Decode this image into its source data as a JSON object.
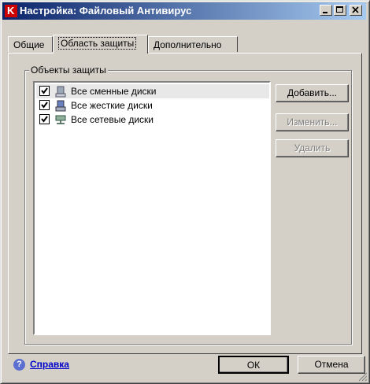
{
  "window": {
    "title": "Настройка: Файловый Антивирус",
    "app_icon_letter": "K",
    "caption_buttons": [
      "minimize-icon",
      "maximize-icon",
      "close-icon"
    ]
  },
  "tabs": [
    {
      "label": "Общие",
      "active": false
    },
    {
      "label": "Область защиты",
      "active": true
    },
    {
      "label": "Дополнительно",
      "active": false
    }
  ],
  "group": {
    "label": "Объекты защиты",
    "items": [
      {
        "label": "Все сменные диски",
        "checked": true,
        "icon": "removable-drive-icon",
        "selected": true
      },
      {
        "label": "Все жесткие диски",
        "checked": true,
        "icon": "hard-drive-icon",
        "selected": false
      },
      {
        "label": "Все сетевые диски",
        "checked": true,
        "icon": "network-drive-icon",
        "selected": false
      }
    ]
  },
  "buttons": {
    "add": "Добавить...",
    "edit": "Изменить...",
    "delete": "Удалить",
    "ok": "ОК",
    "cancel": "Отмена"
  },
  "help": {
    "label": "Справка",
    "icon": "help-icon"
  },
  "colors": {
    "title_start": "#0a246a",
    "title_end": "#a6caf0",
    "face": "#d4d0c8",
    "link": "#0000cc"
  }
}
